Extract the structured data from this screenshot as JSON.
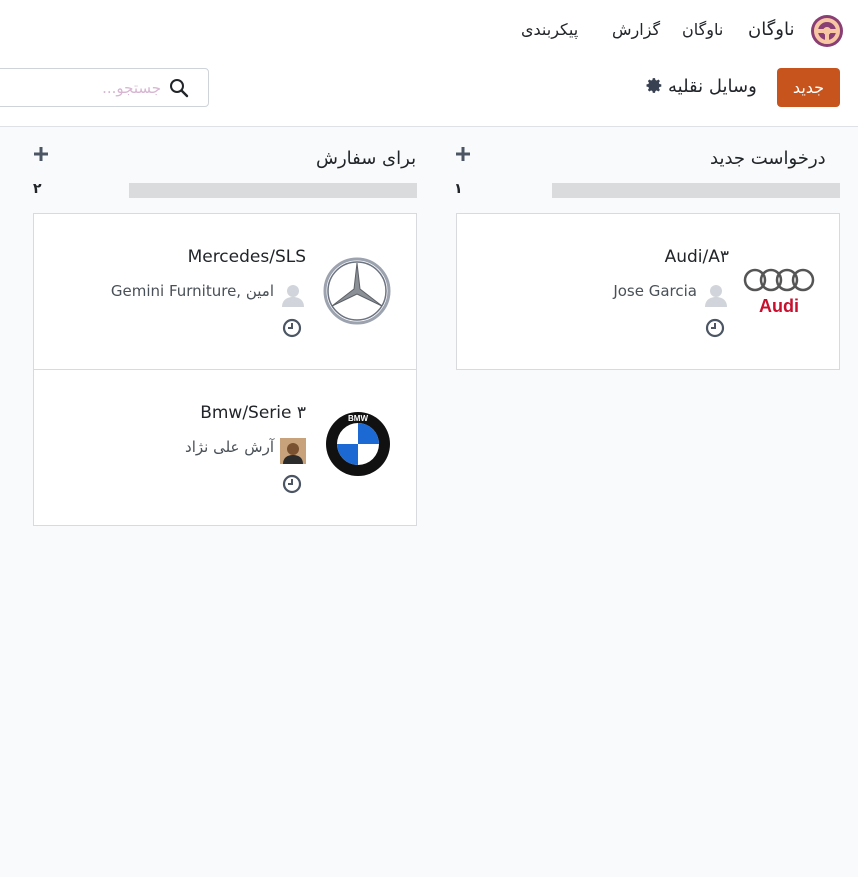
{
  "navbar": {
    "app_name": "ناوگان",
    "menu": [
      "ناوگان",
      "گزارش",
      "پیکربندی"
    ]
  },
  "control_panel": {
    "new_button": "جدید",
    "title": "وسایل نقلیه",
    "search_placeholder": "جستجو..."
  },
  "columns": [
    {
      "title": "درخواست جدید",
      "count": "۱",
      "cards": [
        {
          "title": "Audi/A۳",
          "driver": "Jose Garcia",
          "logo": "audi-logo"
        }
      ]
    },
    {
      "title": "برای سفارش",
      "count": "۲",
      "cards": [
        {
          "title": "Mercedes/SLS",
          "driver": "Gemini Furniture, امین",
          "logo": "mercedes-logo"
        },
        {
          "title": "Bmw/Serie ۳",
          "driver": "آرش علی نژاد",
          "logo": "bmw-logo"
        }
      ]
    }
  ],
  "colors": {
    "accent": "#c8541d",
    "logo_ring": "#8a3f74",
    "logo_accent": "#f7c7a3"
  }
}
